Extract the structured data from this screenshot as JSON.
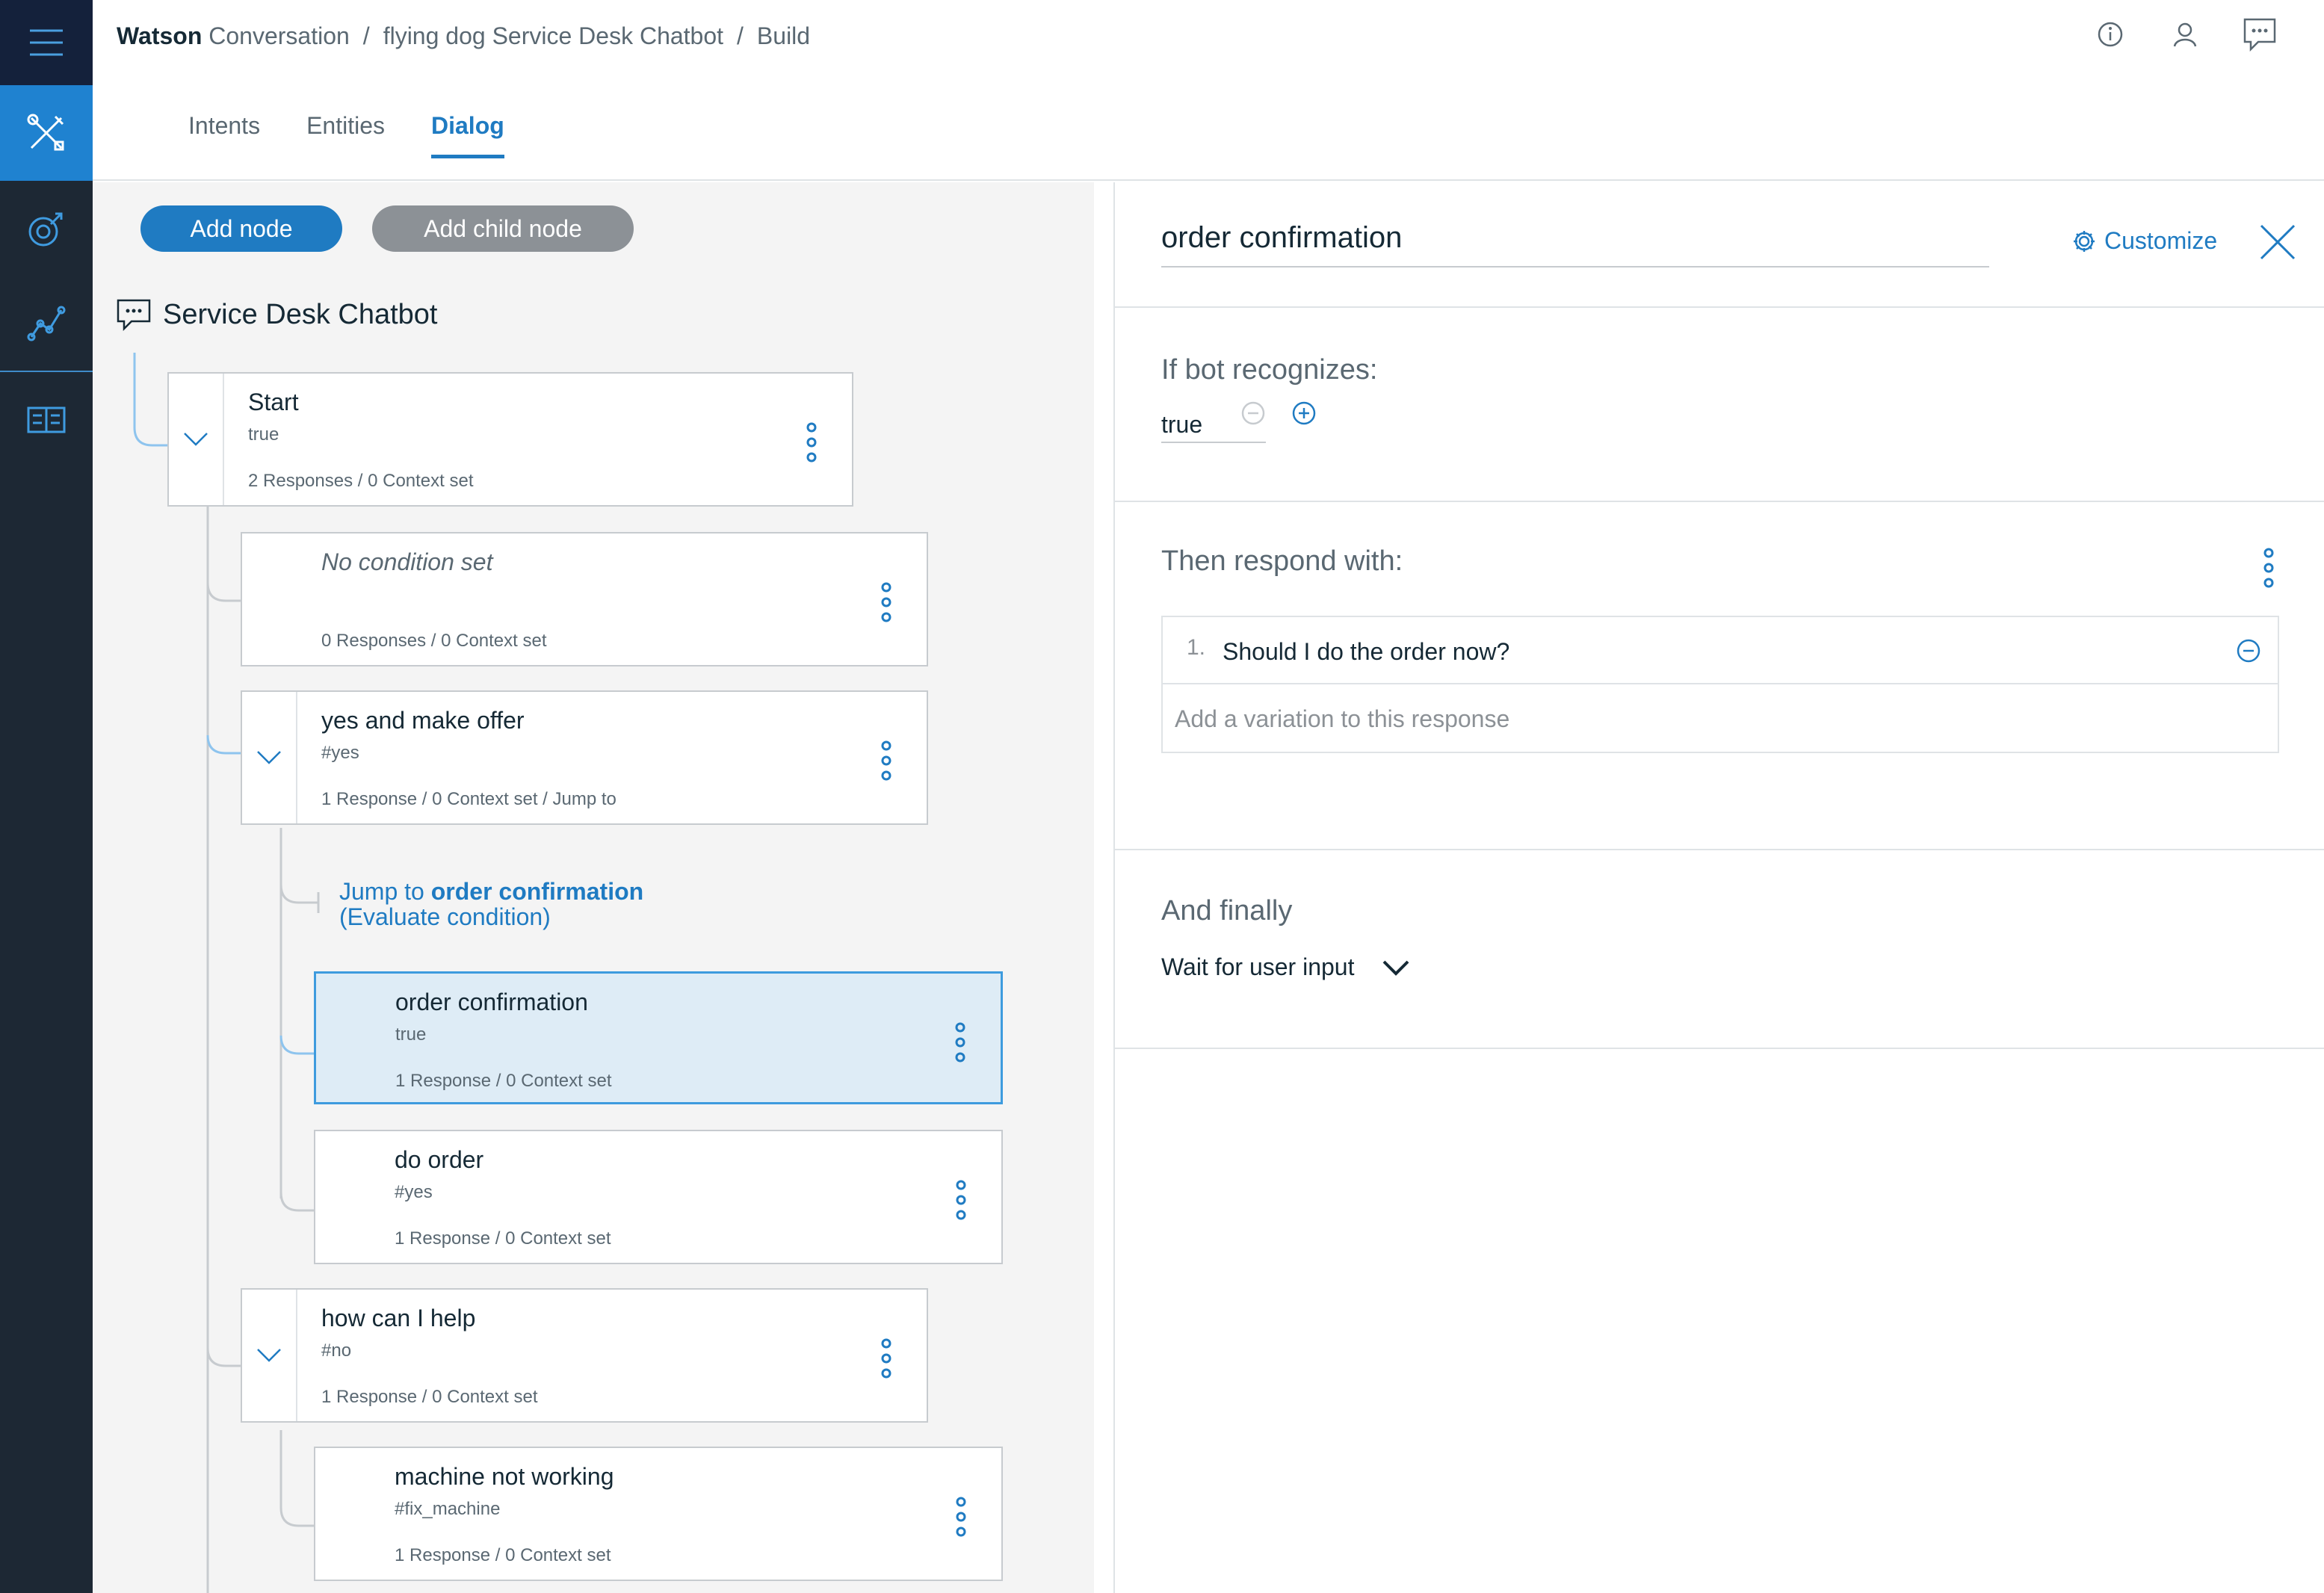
{
  "breadcrumb": {
    "brand_bold": "Watson",
    "brand_rest": "Conversation",
    "sep1": "/",
    "workspace": "flying dog Service Desk Chatbot",
    "sep2": "/",
    "page": "Build"
  },
  "tabs": [
    {
      "label": "Intents"
    },
    {
      "label": "Entities"
    },
    {
      "label": "Dialog"
    }
  ],
  "toolbar": {
    "add_node": "Add node",
    "add_child_node": "Add child node"
  },
  "tree": {
    "title": "Service Desk Chatbot",
    "nodes": [
      {
        "title": "Start",
        "condition": "true",
        "meta": "2 Responses / 0 Context set"
      },
      {
        "title": "No condition set",
        "condition": "",
        "meta": "0 Responses / 0 Context set"
      },
      {
        "title": "yes and make offer",
        "condition": "#yes",
        "meta": "1 Response / 0 Context set / Jump to"
      },
      {
        "title": "order confirmation",
        "condition": "true",
        "meta": "1 Response / 0 Context set"
      },
      {
        "title": "do order",
        "condition": "#yes",
        "meta": "1 Response / 0 Context set"
      },
      {
        "title": "how can I help",
        "condition": "#no",
        "meta": "1 Response / 0 Context set"
      },
      {
        "title": "machine not working",
        "condition": "#fix_machine",
        "meta": "1 Response / 0 Context set"
      }
    ],
    "jump": {
      "prefix": "Jump to",
      "target": "order confirmation",
      "note": "(Evaluate condition)"
    }
  },
  "editor": {
    "node_name": "order confirmation",
    "customize": "Customize",
    "if_title": "If bot recognizes:",
    "if_value": "true",
    "then_title": "Then respond with:",
    "responses": [
      {
        "num": "1.",
        "text": "Should I do the order now?"
      }
    ],
    "add_variation": "Add a variation to this response",
    "finally_title": "And finally",
    "finally_value": "Wait for user input"
  },
  "colors": {
    "accent": "#1f7bc2",
    "rail": "#1d2834",
    "rail_active": "#1f82d0",
    "selected_node": "#deecf6"
  },
  "icons": [
    "menu-icon",
    "tools-icon",
    "improve-icon",
    "analytics-icon",
    "deploy-icon",
    "info-icon",
    "user-icon",
    "chat-icon",
    "gear-icon",
    "close-icon",
    "chevron-down-icon",
    "kebab-icon",
    "minus-circle-icon",
    "plus-circle-icon"
  ]
}
